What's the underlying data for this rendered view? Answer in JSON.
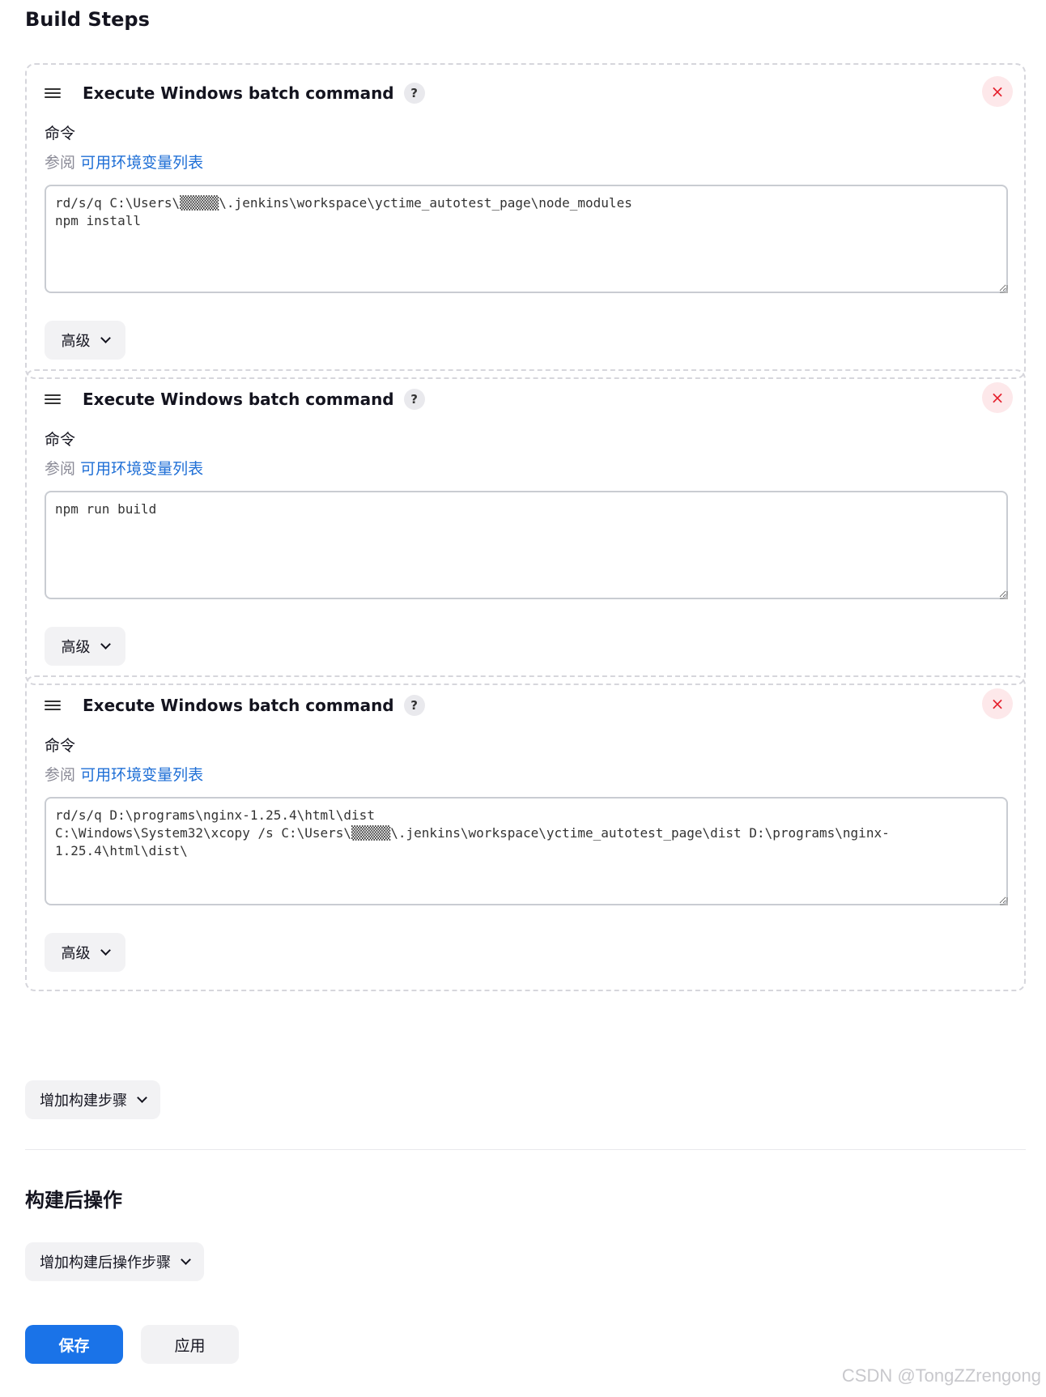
{
  "page": {
    "build_steps_title": "Build Steps",
    "post_build_title": "构建后操作",
    "add_build_step_label": "增加构建步骤",
    "add_post_build_label": "增加构建后操作步骤",
    "save_label": "保存",
    "apply_label": "应用",
    "watermark": "CSDN @TongZZrengong"
  },
  "steps": [
    {
      "title": "Execute Windows batch command",
      "help": "?",
      "close": "×",
      "field_label": "命令",
      "env_prefix": "参阅",
      "env_link": "可用环境变量列表",
      "command": "rd/s/q C:\\Users\\▒▒▒▒▒\\.jenkins\\workspace\\yctime_autotest_page\\node_modules\nnpm install",
      "advanced_label": "高级"
    },
    {
      "title": "Execute Windows batch command",
      "help": "?",
      "close": "×",
      "field_label": "命令",
      "env_prefix": "参阅",
      "env_link": "可用环境变量列表",
      "command": "npm run build",
      "advanced_label": "高级"
    },
    {
      "title": "Execute Windows batch command",
      "help": "?",
      "close": "×",
      "field_label": "命令",
      "env_prefix": "参阅",
      "env_link": "可用环境变量列表",
      "command": "rd/s/q D:\\programs\\nginx-1.25.4\\html\\dist\nC:\\Windows\\System32\\xcopy /s C:\\Users\\▒▒▒▒▒\\.jenkins\\workspace\\yctime_autotest_page\\dist D:\\programs\\nginx-\n1.25.4\\html\\dist\\",
      "advanced_label": "高级"
    }
  ],
  "colors": {
    "primary": "#1a73e8",
    "link": "#1f6fd6",
    "danger": "#e5212e",
    "danger_bg": "#fde8ea"
  }
}
